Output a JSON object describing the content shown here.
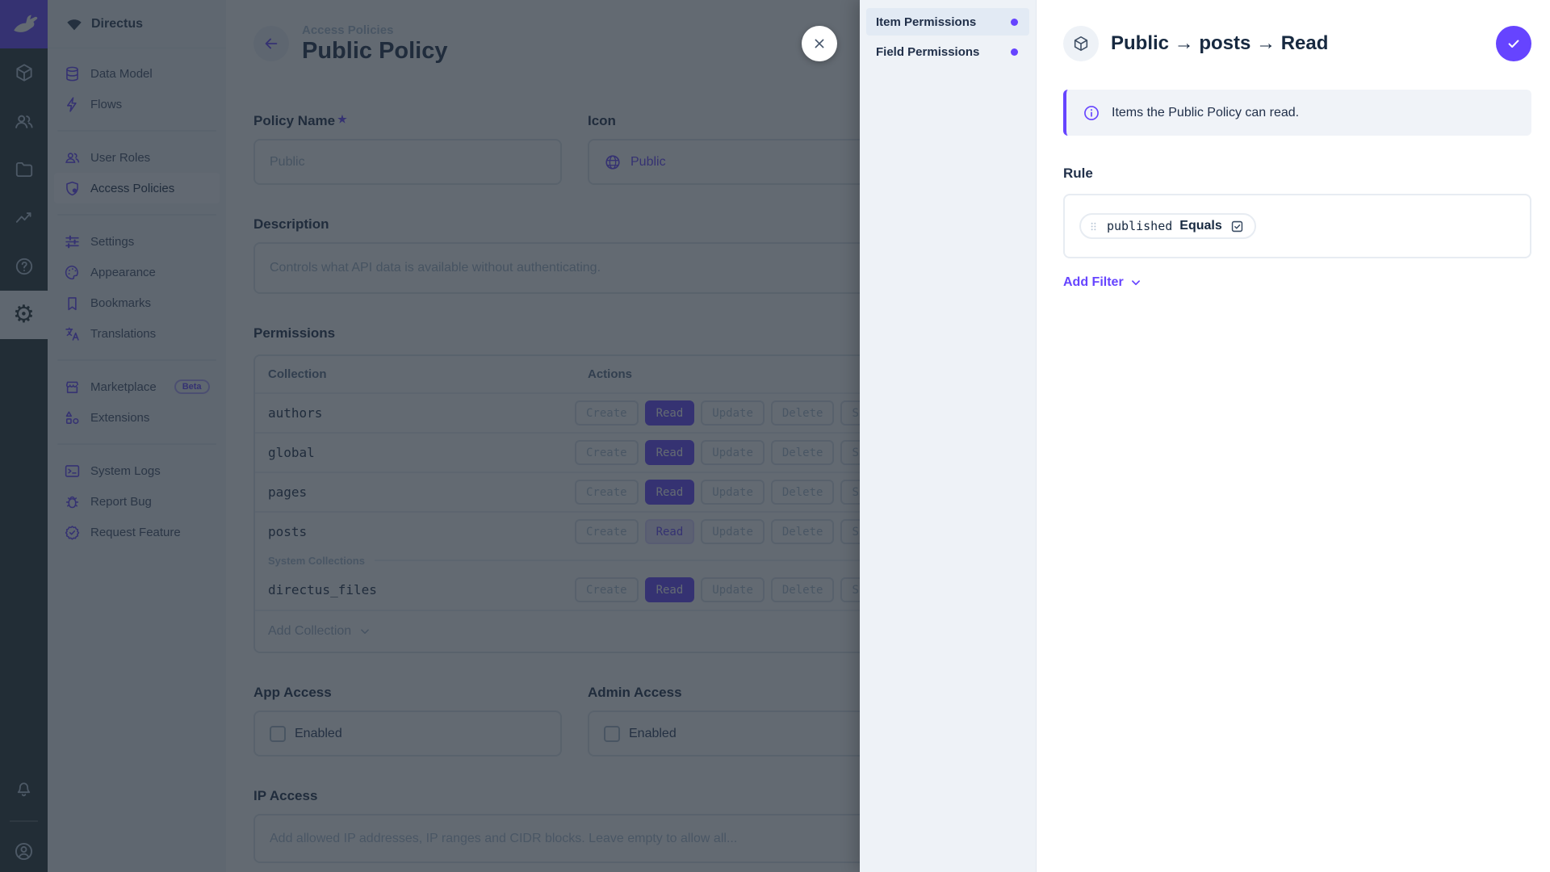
{
  "app": {
    "project_name": "Directus"
  },
  "module_bar": {
    "modules": [
      "content",
      "user-directory",
      "file-library",
      "insights",
      "documentation",
      "settings"
    ],
    "active_module": "settings",
    "bottom": [
      "notifications",
      "account"
    ]
  },
  "sidebar": {
    "items": [
      {
        "label": "Data Model",
        "icon": "database-icon"
      },
      {
        "label": "Flows",
        "icon": "bolt-icon"
      },
      {
        "label": "User Roles",
        "icon": "people-icon"
      },
      {
        "label": "Access Policies",
        "icon": "shield-lock-icon",
        "active": true
      },
      {
        "label": "Settings",
        "icon": "tune-icon"
      },
      {
        "label": "Appearance",
        "icon": "palette-icon"
      },
      {
        "label": "Bookmarks",
        "icon": "bookmark-icon"
      },
      {
        "label": "Translations",
        "icon": "translate-icon"
      },
      {
        "label": "Marketplace",
        "icon": "storefront-icon",
        "badge": "Beta"
      },
      {
        "label": "Extensions",
        "icon": "shapes-icon"
      },
      {
        "label": "System Logs",
        "icon": "terminal-icon"
      },
      {
        "label": "Report Bug",
        "icon": "bug-icon"
      },
      {
        "label": "Request Feature",
        "icon": "badge-check-icon"
      }
    ]
  },
  "page": {
    "breadcrumb": "Access Policies",
    "title": "Public Policy",
    "fields": {
      "policy_name": {
        "label": "Policy Name",
        "required": true,
        "value": "Public"
      },
      "icon": {
        "label": "Icon",
        "value": "Public",
        "icon": "globe-icon"
      },
      "description": {
        "label": "Description",
        "value": "Controls what API data is available without authenticating."
      },
      "app_access": {
        "label": "App Access",
        "checkbox_label": "Enabled",
        "checked": false
      },
      "admin_access": {
        "label": "Admin Access",
        "checkbox_label": "Enabled",
        "checked": false
      },
      "ip_access": {
        "label": "IP Access",
        "placeholder": "Add allowed IP addresses, IP ranges and CIDR blocks. Leave empty to allow all..."
      }
    },
    "permissions": {
      "label": "Permissions",
      "columns": {
        "collection": "Collection",
        "actions": "Actions"
      },
      "actions": [
        "Create",
        "Read",
        "Update",
        "Delete",
        "Share"
      ],
      "system_divider": "System Collections",
      "add_collection": "Add Collection",
      "rows": [
        {
          "collection": "authors",
          "active_action": "Read",
          "active_style": "solid"
        },
        {
          "collection": "global",
          "active_action": "Read",
          "active_style": "solid"
        },
        {
          "collection": "pages",
          "active_action": "Read",
          "active_style": "solid"
        },
        {
          "collection": "posts",
          "active_action": "Read",
          "active_style": "tint"
        },
        {
          "collection": "directus_files",
          "active_action": "Read",
          "active_style": "solid",
          "system": true
        }
      ]
    }
  },
  "drawer": {
    "nav": [
      {
        "label": "Item Permissions",
        "active": true
      },
      {
        "label": "Field Permissions",
        "active": false
      }
    ],
    "title": "Public → posts → Read",
    "notice": "Items the Public Policy can read.",
    "rule": {
      "label": "Rule",
      "field": "published",
      "operator": "Equals",
      "value_checked": true
    },
    "add_filter": "Add Filter"
  },
  "colors": {
    "primary": "#6644ff",
    "module_bar": "#263238",
    "sidebar_bg": "#f0f4f9"
  }
}
